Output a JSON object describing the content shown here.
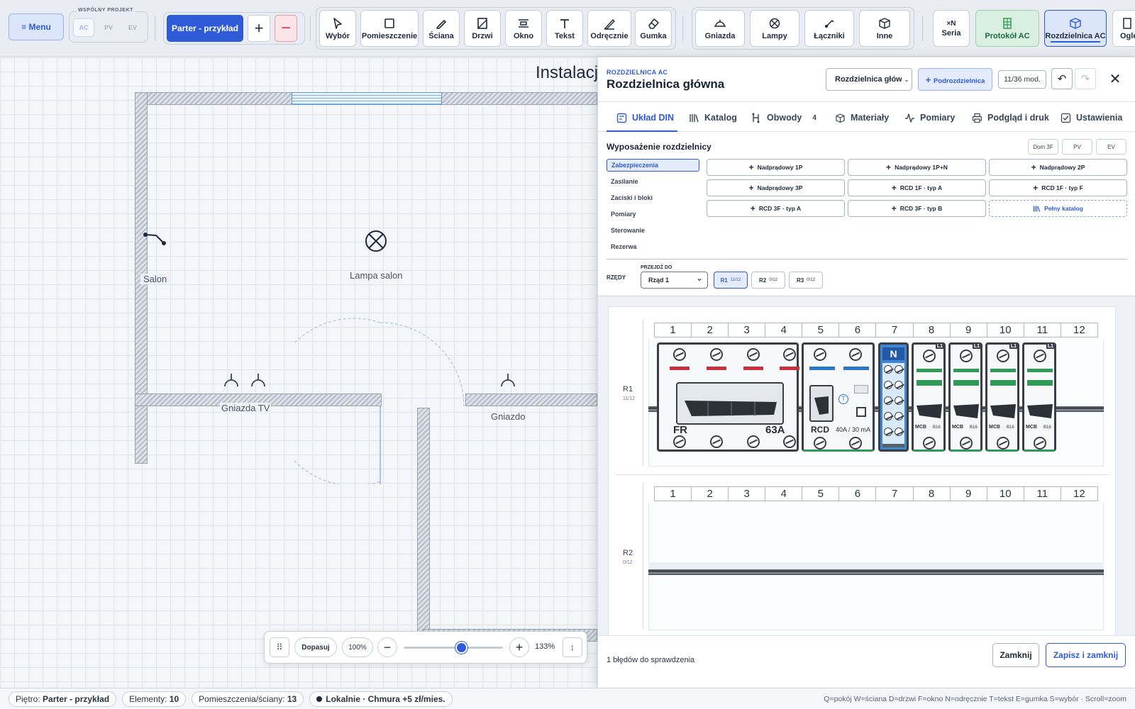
{
  "toolbar": {
    "menu_label": "≡ Menu",
    "shared_project": {
      "title": "WSPÓLNY PROJEKT",
      "modes": [
        "AC",
        "PV",
        "EV"
      ]
    },
    "floor_label": "Parter - przykład",
    "tools": [
      "Wybór",
      "Pomieszczenie",
      "Ściana",
      "Drzwi",
      "Okno",
      "Tekst",
      "Odręcznie",
      "Gumka"
    ],
    "elements": [
      "Gniazda",
      "Lampy",
      "Łączniki",
      "Inne"
    ],
    "seria_top": "×N",
    "seria_label": "Seria",
    "protokol_label": "Protokół AC",
    "rozdzielnica_label": "Rozdzielnica AC",
    "oglad_label": "Oględ"
  },
  "canvas": {
    "title": "Instalacj",
    "labels": {
      "salon": "Salon",
      "lampa": "Lampa salon",
      "gniazda_tv": "Gniazda TV",
      "gniazdo": "Gniazdo"
    },
    "zoom": {
      "fit": "Dopasuj",
      "percent": "100%",
      "level": "133%",
      "slider_value": 0.58
    }
  },
  "panel": {
    "kicker": "ROZDZIELNICA AC",
    "title": "Rozdzielnica główna",
    "select_value": "Rozdzielnica główna",
    "sub_button": "Podrozdzielnica",
    "mod_count": "11/36 mod.",
    "tabs": [
      {
        "label": "Układ DIN",
        "icon": "din-layout-icon",
        "active": true
      },
      {
        "label": "Katalog",
        "icon": "catalog-icon"
      },
      {
        "label": "Obwody",
        "icon": "circuits-icon",
        "badge": "4"
      },
      {
        "label": "Materiały",
        "icon": "box-icon"
      },
      {
        "label": "Pomiary",
        "icon": "measure-icon"
      },
      {
        "label": "Podgląd i druk",
        "icon": "printer-icon"
      },
      {
        "label": "Ustawienia",
        "icon": "checkbox-icon"
      }
    ],
    "equip_title": "Wyposażenie rozdzielnicy",
    "presets": [
      "Dom 3F",
      "PV",
      "EV"
    ],
    "categories": [
      "Zabezpieczenia",
      "Zasilanie",
      "Zaciski i bloki",
      "Pomiary",
      "Sterowanie",
      "Rezerwa"
    ],
    "add_buttons": [
      "Nadprądowy 1P",
      "Nadprądowy 1P+N",
      "Nadprądowy 2P",
      "Nadprądowy 3P",
      "RCD 1F · typ A",
      "RCD 1F · typ F",
      "RCD 3F · typ A",
      "RCD 3F · typ B"
    ],
    "full_catalog": "Pełny katalog",
    "rows_label": "RZĘDY",
    "goto_label": "PRZEJDŹ DO",
    "goto_value": "Rząd 1",
    "row_buttons": [
      {
        "name": "R1",
        "count": "11/12"
      },
      {
        "name": "R2",
        "count": "0/12"
      },
      {
        "name": "R3",
        "count": "0/12"
      }
    ],
    "din": {
      "slots": [
        "1",
        "2",
        "3",
        "4",
        "5",
        "6",
        "7",
        "8",
        "9",
        "10",
        "11",
        "12"
      ],
      "rows": [
        {
          "name": "R1",
          "count": "11/12"
        },
        {
          "name": "R2",
          "count": "0/12"
        }
      ],
      "fr": {
        "label": "FR",
        "rating": "63A"
      },
      "rcd": {
        "label": "RCD",
        "rating": "40A / 30 mA",
        "test": "T"
      },
      "n_label": "N",
      "mcb": {
        "phase": "L1",
        "label": "MCB",
        "rating": "B16"
      }
    },
    "footer": {
      "errors": "1 błędów do sprawdzenia",
      "close": "Zamknij",
      "save": "Zapisz i zamknij"
    }
  },
  "status": {
    "floor_key": "Piętro:",
    "floor_val": "Parter - przykład",
    "elements_key": "Elementy:",
    "elements_val": "10",
    "rooms_key": "Pomieszczenia/ściany:",
    "rooms_val": "13",
    "storage": "Lokalnie · Chmura +5 zł/mies.",
    "shortcuts": "Q=pokój W=ściana D=drzwi F=okno N=odręcznie T=tekst E=gumka S=wybór · Scroll=zoom"
  },
  "colors": {
    "accent": "#2f5bd8",
    "danger": "#d8394a",
    "green": "#2f9a57"
  }
}
